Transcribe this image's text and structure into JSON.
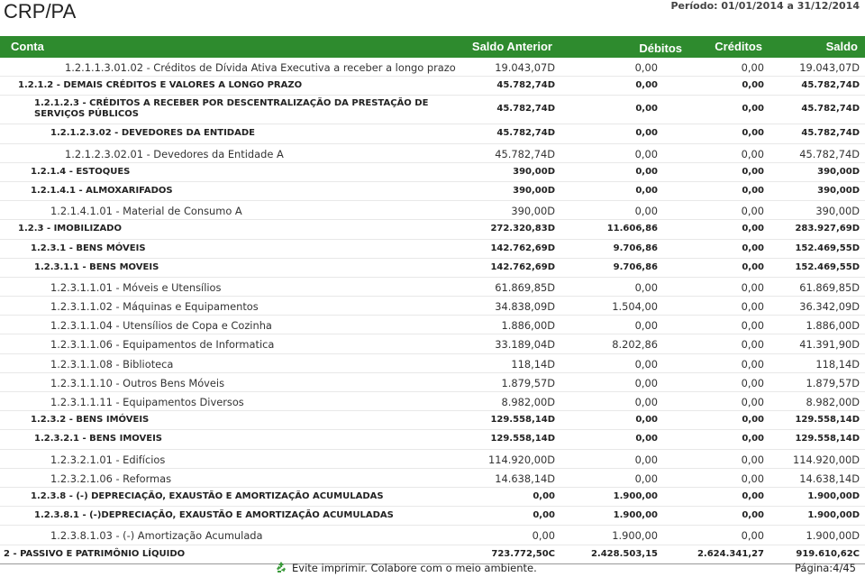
{
  "report": {
    "title": "CRP/PA",
    "period": "Período: 01/01/2014 a 31/12/2014"
  },
  "header": {
    "conta": "Conta",
    "saldo_anterior": "Saldo Anterior",
    "debitos": "Débitos",
    "creditos": "Créditos",
    "saldo": "Saldo"
  },
  "rows": [
    {
      "desc": "1.2.1.1.3.01.02 - Créditos de Dívida Ativa Executiva a receber a longo prazo",
      "ant": "19.043,07D",
      "deb": "0,00",
      "cred": "0,00",
      "sal": "19.043,07D",
      "bold": false
    },
    {
      "desc": "1.2.1.2 - DEMAIS CRÉDITOS E VALORES A LONGO PRAZO",
      "ant": "45.782,74D",
      "deb": "0,00",
      "cred": "0,00",
      "sal": "45.782,74D",
      "bold": true
    },
    {
      "desc": "1.2.1.2.3 - CRÉDITOS A RECEBER POR DESCENTRALIZAÇÃO DA PRESTAÇÃO DE SERVIÇOS PÚBLICOS",
      "ant": "45.782,74D",
      "deb": "0,00",
      "cred": "0,00",
      "sal": "45.782,74D",
      "bold": true
    },
    {
      "desc": "1.2.1.2.3.02 - DEVEDORES DA ENTIDADE",
      "ant": "45.782,74D",
      "deb": "0,00",
      "cred": "0,00",
      "sal": "45.782,74D",
      "bold": true
    },
    {
      "desc": "1.2.1.2.3.02.01 - Devedores da Entidade A",
      "ant": "45.782,74D",
      "deb": "0,00",
      "cred": "0,00",
      "sal": "45.782,74D",
      "bold": false
    },
    {
      "desc": "1.2.1.4 - ESTOQUES",
      "ant": "390,00D",
      "deb": "0,00",
      "cred": "0,00",
      "sal": "390,00D",
      "bold": true
    },
    {
      "desc": "1.2.1.4.1 - ALMOXARIFADOS",
      "ant": "390,00D",
      "deb": "0,00",
      "cred": "0,00",
      "sal": "390,00D",
      "bold": true
    },
    {
      "desc": "1.2.1.4.1.01 - Material de Consumo A",
      "ant": "390,00D",
      "deb": "0,00",
      "cred": "0,00",
      "sal": "390,00D",
      "bold": false
    },
    {
      "desc": "1.2.3 - IMOBILIZADO",
      "ant": "272.320,83D",
      "deb": "11.606,86",
      "cred": "0,00",
      "sal": "283.927,69D",
      "bold": true
    },
    {
      "desc": "1.2.3.1 - BENS MÓVEIS",
      "ant": "142.762,69D",
      "deb": "9.706,86",
      "cred": "0,00",
      "sal": "152.469,55D",
      "bold": true
    },
    {
      "desc": "1.2.3.1.1 - BENS MOVEIS",
      "ant": "142.762,69D",
      "deb": "9.706,86",
      "cred": "0,00",
      "sal": "152.469,55D",
      "bold": true
    },
    {
      "desc": "1.2.3.1.1.01 - Móveis e Utensílios",
      "ant": "61.869,85D",
      "deb": "0,00",
      "cred": "0,00",
      "sal": "61.869,85D",
      "bold": false
    },
    {
      "desc": "1.2.3.1.1.02 - Máquinas e Equipamentos",
      "ant": "34.838,09D",
      "deb": "1.504,00",
      "cred": "0,00",
      "sal": "36.342,09D",
      "bold": false
    },
    {
      "desc": "1.2.3.1.1.04 - Utensílios de Copa e Cozinha",
      "ant": "1.886,00D",
      "deb": "0,00",
      "cred": "0,00",
      "sal": "1.886,00D",
      "bold": false
    },
    {
      "desc": "1.2.3.1.1.06 - Equipamentos de Informatica",
      "ant": "33.189,04D",
      "deb": "8.202,86",
      "cred": "0,00",
      "sal": "41.391,90D",
      "bold": false
    },
    {
      "desc": "1.2.3.1.1.08 - Biblioteca",
      "ant": "118,14D",
      "deb": "0,00",
      "cred": "0,00",
      "sal": "118,14D",
      "bold": false
    },
    {
      "desc": "1.2.3.1.1.10 - Outros Bens Móveis",
      "ant": "1.879,57D",
      "deb": "0,00",
      "cred": "0,00",
      "sal": "1.879,57D",
      "bold": false
    },
    {
      "desc": "1.2.3.1.1.11 - Equipamentos Diversos",
      "ant": "8.982,00D",
      "deb": "0,00",
      "cred": "0,00",
      "sal": "8.982,00D",
      "bold": false
    },
    {
      "desc": "1.2.3.2 - BENS IMÓVEIS",
      "ant": "129.558,14D",
      "deb": "0,00",
      "cred": "0,00",
      "sal": "129.558,14D",
      "bold": true
    },
    {
      "desc": "1.2.3.2.1 - BENS IMOVEIS",
      "ant": "129.558,14D",
      "deb": "0,00",
      "cred": "0,00",
      "sal": "129.558,14D",
      "bold": true
    },
    {
      "desc": "1.2.3.2.1.01 - Edifícios",
      "ant": "114.920,00D",
      "deb": "0,00",
      "cred": "0,00",
      "sal": "114.920,00D",
      "bold": false
    },
    {
      "desc": "1.2.3.2.1.06 - Reformas",
      "ant": "14.638,14D",
      "deb": "0,00",
      "cred": "0,00",
      "sal": "14.638,14D",
      "bold": false
    },
    {
      "desc": "1.2.3.8 - (-) DEPRECIAÇÃO, EXAUSTÃO E AMORTIZAÇÃO ACUMULADAS",
      "ant": "0,00",
      "deb": "1.900,00",
      "cred": "0,00",
      "sal": "1.900,00D",
      "bold": true
    },
    {
      "desc": "1.2.3.8.1 - (-)DEPRECIAÇÃO, EXAUSTÃO E AMORTIZAÇÃO ACUMULADAS",
      "ant": "0,00",
      "deb": "1.900,00",
      "cred": "0,00",
      "sal": "1.900,00D",
      "bold": true
    },
    {
      "desc": "1.2.3.8.1.03 - (-) Amortização Acumulada",
      "ant": "0,00",
      "deb": "1.900,00",
      "cred": "0,00",
      "sal": "1.900,00D",
      "bold": false
    },
    {
      "desc": "2 - PASSIVO E PATRIMÔNIO LÍQUIDO",
      "ant": "723.772,50C",
      "deb": "2.428.503,15",
      "cred": "2.624.341,27",
      "sal": "919.610,62C",
      "bold": true
    }
  ],
  "footer": {
    "message": "Evite imprimir. Colabore com o meio ambiente.",
    "page": "Página:4/45",
    "icon": "recycle-icon"
  },
  "colors": {
    "header_bg": "#2e8b2e",
    "recycle": "#3a9a3a"
  }
}
